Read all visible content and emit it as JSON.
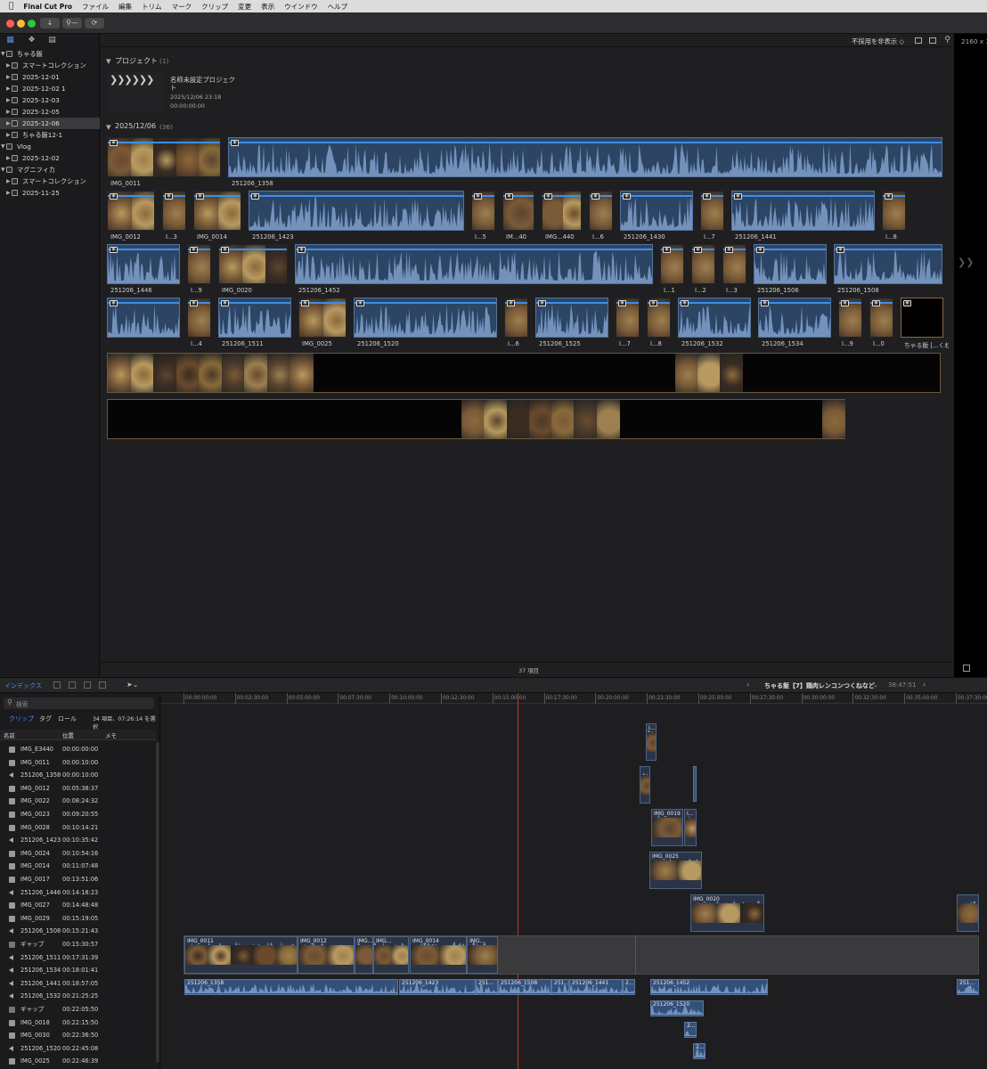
{
  "menu": {
    "apple": "",
    "app": "Final Cut Pro",
    "items": [
      "ファイル",
      "編集",
      "トリム",
      "マーク",
      "クリップ",
      "変更",
      "表示",
      "ウインドウ",
      "ヘルプ"
    ]
  },
  "toolbar": {
    "import_icon": "download-icon",
    "keyword_icon": "key-icon",
    "bg_tasks_icon": "refresh-icon"
  },
  "library": {
    "rows": [
      {
        "label": "ちゃる飯",
        "level": 0,
        "type": "library"
      },
      {
        "label": "スマートコレクション",
        "level": 1,
        "type": "folder"
      },
      {
        "label": "2025-12-01",
        "level": 1,
        "type": "event"
      },
      {
        "label": "2025-12-02 1",
        "level": 1,
        "type": "event"
      },
      {
        "label": "2025-12-03",
        "level": 1,
        "type": "event"
      },
      {
        "label": "2025-12-05",
        "level": 1,
        "type": "event"
      },
      {
        "label": "2025-12-06",
        "level": 1,
        "type": "event",
        "selected": true
      },
      {
        "label": "ちゃる飯12-1",
        "level": 1,
        "type": "event"
      },
      {
        "label": "Vlog",
        "level": 0,
        "type": "library"
      },
      {
        "label": "2025-12-02",
        "level": 1,
        "type": "event"
      },
      {
        "label": "マグニフィカ",
        "level": 0,
        "type": "library"
      },
      {
        "label": "スマートコレクション",
        "level": 1,
        "type": "folder"
      },
      {
        "label": "2025-11-25",
        "level": 1,
        "type": "event"
      }
    ]
  },
  "browser": {
    "filter": "不採用を非表示 ◇",
    "resolution": "2160 x 3",
    "project_section": "プロジェクト",
    "project_count": "(1)",
    "project": {
      "name": "名称未設定プロジェクト",
      "date": "2025/12/06 23:18",
      "duration": "00:00:00:00"
    },
    "date_section": "2025/12/06",
    "date_count": "(36)",
    "footer": "37 項目",
    "row1": [
      {
        "label": "IMG_0011",
        "kind": "video",
        "w": 128
      },
      {
        "label": "251206_1358",
        "kind": "audio",
        "w": 802
      }
    ],
    "row2": [
      {
        "label": "IMG_0012",
        "kind": "video",
        "w": 54
      },
      {
        "label": "I...3",
        "kind": "video",
        "w": 27
      },
      {
        "label": "IMG_0014",
        "kind": "video",
        "w": 54
      },
      {
        "label": "251206_1423",
        "kind": "audio",
        "w": 242
      },
      {
        "label": "I...5",
        "kind": "video",
        "w": 27
      },
      {
        "label": "IM...40",
        "kind": "video",
        "w": 36
      },
      {
        "label": "IMG...440",
        "kind": "video",
        "w": 45
      },
      {
        "label": "I...6",
        "kind": "video",
        "w": 27
      },
      {
        "label": "251206_1430",
        "kind": "audio",
        "w": 82
      },
      {
        "label": "I...7",
        "kind": "video",
        "w": 27
      },
      {
        "label": "251206_1441",
        "kind": "audio",
        "w": 161
      },
      {
        "label": "I...8",
        "kind": "video",
        "w": 27
      }
    ],
    "row3": [
      {
        "label": "251206_1446",
        "kind": "audio",
        "w": 82
      },
      {
        "label": "I...9",
        "kind": "video",
        "w": 27
      },
      {
        "label": "IMG_0020",
        "kind": "video",
        "w": 78
      },
      {
        "label": "251206_1452",
        "kind": "audio",
        "w": 402
      },
      {
        "label": "I...1",
        "kind": "video",
        "w": 27
      },
      {
        "label": "I...2",
        "kind": "video",
        "w": 27
      },
      {
        "label": "I...3",
        "kind": "video",
        "w": 27
      },
      {
        "label": "251206_1506",
        "kind": "audio",
        "w": 82
      },
      {
        "label": "251206_1508",
        "kind": "audio",
        "w": 122
      }
    ],
    "row4": [
      {
        "label": "",
        "kind": "audio",
        "w": 82
      },
      {
        "label": "I...4",
        "kind": "video",
        "w": 27
      },
      {
        "label": "251206_1511",
        "kind": "audio",
        "w": 82
      },
      {
        "label": "IMG_0025",
        "kind": "video",
        "w": 54
      },
      {
        "label": "251206_1520",
        "kind": "audio",
        "w": 161
      },
      {
        "label": "I...6",
        "kind": "video",
        "w": 27
      },
      {
        "label": "251206_1525",
        "kind": "audio",
        "w": 82
      },
      {
        "label": "I...7",
        "kind": "video",
        "w": 27
      },
      {
        "label": "I...8",
        "kind": "video",
        "w": 27
      },
      {
        "label": "251206_1532",
        "kind": "audio",
        "w": 82
      },
      {
        "label": "251206_1534",
        "kind": "audio",
        "w": 82
      },
      {
        "label": "I...9",
        "kind": "video",
        "w": 27
      },
      {
        "label": "I...0",
        "kind": "video",
        "w": 27
      },
      {
        "label": "ちゃる飯 [...くね",
        "kind": "project",
        "w": 48
      }
    ]
  },
  "timeline_bar": {
    "index_label": "インデックス",
    "project_title": "ちゃる飯【7】鶏肉レンコンつくねなど",
    "duration": "38:47:51"
  },
  "index": {
    "search_placeholder": "検索",
    "tabs": [
      "クリップ",
      "タグ",
      "ロール"
    ],
    "summary": "34 項目、07:26:14 を選択",
    "columns": [
      "名前",
      "位置",
      "メモ"
    ],
    "rows": [
      {
        "name": "IMG_E3440",
        "pos": "00:00:00:00",
        "type": "video"
      },
      {
        "name": "IMG_0011",
        "pos": "00:00:10:00",
        "type": "video"
      },
      {
        "name": "251206_1358",
        "pos": "00:00:10:00",
        "type": "audio"
      },
      {
        "name": "IMG_0012",
        "pos": "00:05:38:37",
        "type": "video"
      },
      {
        "name": "IMG_0022",
        "pos": "00:08:24:32",
        "type": "video"
      },
      {
        "name": "IMG_0023",
        "pos": "00:09:20:55",
        "type": "video"
      },
      {
        "name": "IMG_0028",
        "pos": "00:10:14:21",
        "type": "video"
      },
      {
        "name": "251206_1423",
        "pos": "00:10:35:42",
        "type": "audio"
      },
      {
        "name": "IMG_0024",
        "pos": "00:10:54:16",
        "type": "video"
      },
      {
        "name": "IMG_0014",
        "pos": "00:11:07:48",
        "type": "video"
      },
      {
        "name": "IMG_0017",
        "pos": "00:13:51:06",
        "type": "video"
      },
      {
        "name": "251206_1446",
        "pos": "00:14:18:23",
        "type": "audio"
      },
      {
        "name": "IMG_0027",
        "pos": "00:14:48:48",
        "type": "video"
      },
      {
        "name": "IMG_0029",
        "pos": "00:15:19:05",
        "type": "video"
      },
      {
        "name": "251206_1508",
        "pos": "00:15:21:43",
        "type": "audio"
      },
      {
        "name": "ギャップ",
        "pos": "00:15:30:57",
        "type": "gap"
      },
      {
        "name": "251206_1511",
        "pos": "00:17:31:39",
        "type": "audio"
      },
      {
        "name": "251206_1534",
        "pos": "00:18:01:41",
        "type": "audio"
      },
      {
        "name": "251206_1441",
        "pos": "00:18:57:05",
        "type": "audio"
      },
      {
        "name": "251206_1532",
        "pos": "00:21:25:25",
        "type": "audio"
      },
      {
        "name": "ギャップ",
        "pos": "00:22:05:50",
        "type": "gap"
      },
      {
        "name": "IMG_0018",
        "pos": "00:22:15:50",
        "type": "video"
      },
      {
        "name": "IMG_0030",
        "pos": "00:22:36:50",
        "type": "video"
      },
      {
        "name": "251206_1520",
        "pos": "00:22:45:08",
        "type": "audio"
      },
      {
        "name": "IMG_0025",
        "pos": "00:22:46:39",
        "type": "video"
      }
    ]
  },
  "ruler": [
    "00:00:00:00",
    "00:02:30:00",
    "00:05:00:00",
    "00:07:30:00",
    "00:10:00:00",
    "00:12:30:00",
    "00:15:00:00",
    "00:17:30:00",
    "00:20:00:00",
    "00:22:30:00",
    "00:25:00:00",
    "00:27:30:00",
    "00:30:00:00",
    "00:32:30:00",
    "00:35:00:00",
    "00:37:30:00"
  ],
  "timeline": {
    "primary_labels": [
      "IMG_0011",
      "IMG_0012",
      "IMG...",
      "IMG...",
      "IMG_0014",
      "IMG..."
    ],
    "audio_labels": [
      "251206_1358",
      "251206_1423",
      "251...",
      "251206_1508",
      "251...",
      "251206_1441",
      "2...",
      "251206_1452",
      "251206_1520",
      "2...",
      "2...",
      "251..."
    ],
    "connected_labels": [
      "I...",
      "IMG_0019",
      "I...",
      "IMG_0025",
      "IMG_0020"
    ]
  }
}
